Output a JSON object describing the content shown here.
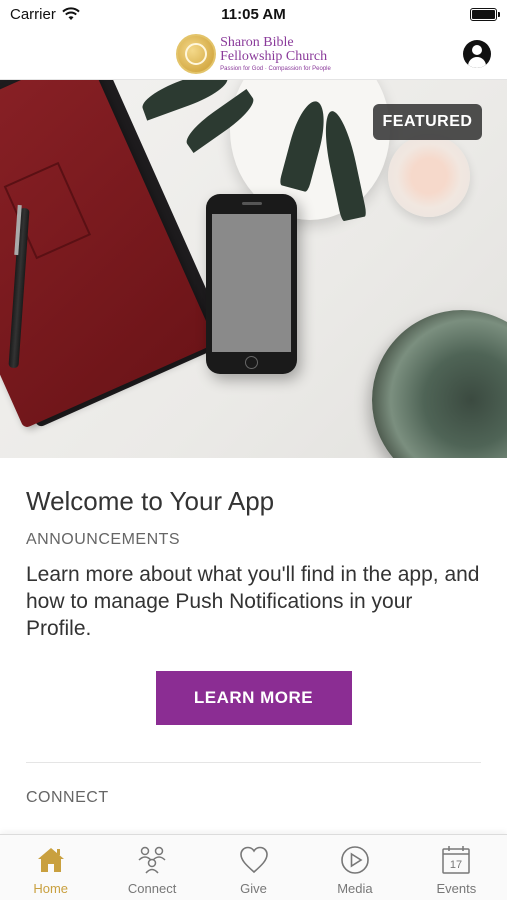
{
  "status_bar": {
    "carrier": "Carrier",
    "time": "11:05 AM"
  },
  "header": {
    "logo_name_line1": "Sharon Bible",
    "logo_name_line2": "Fellowship Church",
    "logo_tagline": "Passion for God · Compassion for People"
  },
  "hero": {
    "badge": "FEATURED"
  },
  "card": {
    "title": "Welcome to Your App",
    "category": "ANNOUNCEMENTS",
    "body": "Learn more about what you'll find in the app, and how to manage Push Notifications in your Profile.",
    "button_label": "LEARN MORE"
  },
  "connect_section": {
    "label": "CONNECT"
  },
  "tabs": [
    {
      "label": "Home",
      "icon": "home-icon",
      "active": true
    },
    {
      "label": "Connect",
      "icon": "people-icon",
      "active": false
    },
    {
      "label": "Give",
      "icon": "heart-icon",
      "active": false
    },
    {
      "label": "Media",
      "icon": "play-icon",
      "active": false
    },
    {
      "label": "Events",
      "icon": "calendar-icon",
      "active": false
    }
  ],
  "calendar_day": "17",
  "colors": {
    "accent": "#8b2d93",
    "tab_active": "#c9a03f",
    "tab_inactive": "#777777"
  }
}
